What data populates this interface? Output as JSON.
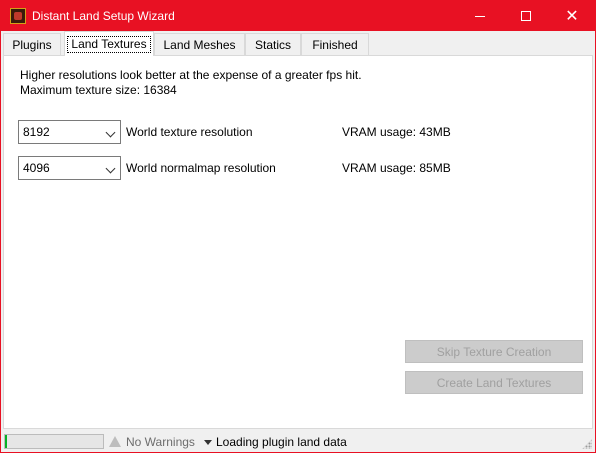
{
  "window": {
    "title": "Distant Land Setup Wizard",
    "accent_color": "#e81123",
    "controls": {
      "minimize_icon": "minimize-icon",
      "maximize_icon": "maximize-icon",
      "close_icon": "close-icon"
    }
  },
  "tabs": [
    {
      "label": "Plugins",
      "active": false
    },
    {
      "label": "Land Textures",
      "active": true
    },
    {
      "label": "Land Meshes",
      "active": false
    },
    {
      "label": "Statics",
      "active": false
    },
    {
      "label": "Finished",
      "active": false
    }
  ],
  "panel": {
    "info_line_1": "Higher resolutions look better at the expense of a greater fps hit.",
    "info_line_2": "Maximum texture size:  16384",
    "texture_row": {
      "value": "8192",
      "label": "World texture resolution",
      "vram": "VRAM usage: 43MB"
    },
    "normalmap_row": {
      "value": "4096",
      "label": "World normalmap resolution",
      "vram": "VRAM usage: 85MB"
    },
    "skip_button": "Skip Texture Creation",
    "create_button": "Create Land Textures"
  },
  "status": {
    "progress_fraction": 0.02,
    "progress_color": "#06b025",
    "warnings": "No Warnings",
    "message": "Loading plugin land data"
  }
}
